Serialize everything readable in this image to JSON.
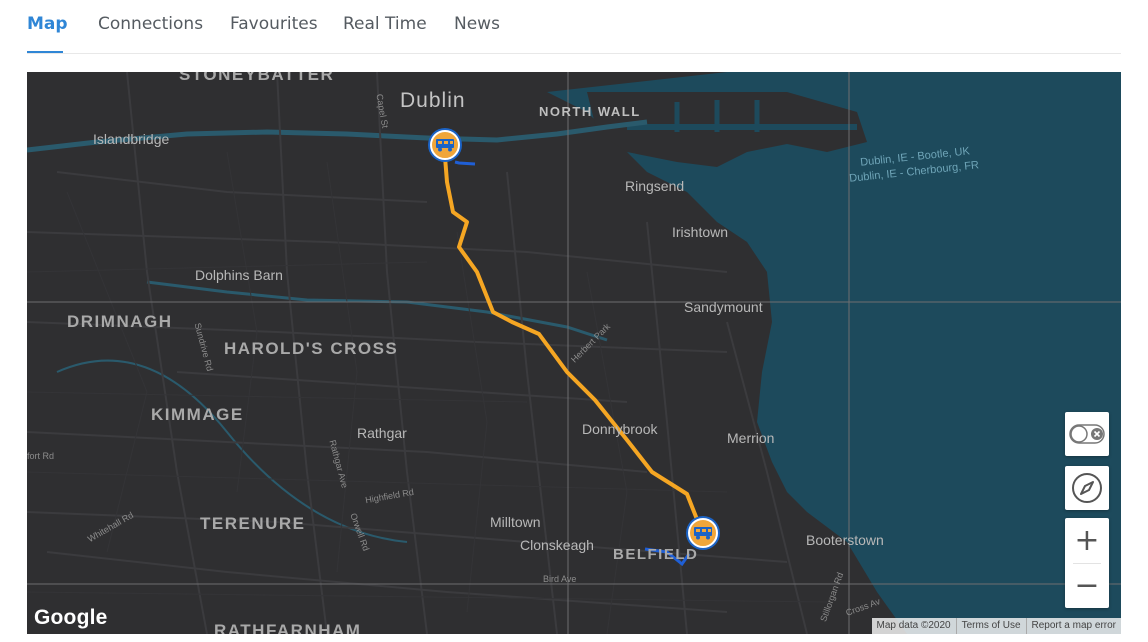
{
  "tabs": [
    {
      "label": "Map",
      "active": true
    },
    {
      "label": "Connections",
      "active": false
    },
    {
      "label": "Favourites",
      "active": false
    },
    {
      "label": "Real Time",
      "active": false
    },
    {
      "label": "News",
      "active": false
    }
  ],
  "map": {
    "labels": {
      "stoneybatter": "STONEYBATTER",
      "dublin": "Dublin",
      "north_wall": "NORTH WALL",
      "islandbridge": "Islandbridge",
      "ringsend": "Ringsend",
      "irishtown": "Irishtown",
      "dolphins_barn": "Dolphins Barn",
      "sandymount": "Sandymount",
      "drimnagh": "DRIMNAGH",
      "harolds_cross": "HAROLD'S CROSS",
      "kimmage": "KIMMAGE",
      "rathgar": "Rathgar",
      "donnybrook": "Donnybrook",
      "merrion": "Merrion",
      "terenure": "TERENURE",
      "milltown": "Milltown",
      "clonskeagh": "Clonskeagh",
      "belfield": "BELFIELD",
      "booterstown": "Booterstown",
      "rathfarnham": "RATHFARNHAM",
      "ferry_bootle": "Dublin, IE - Bootle, UK",
      "ferry_cherbourg": "Dublin, IE - Cherbourg, FR",
      "capel_st": "Capel St",
      "sundrive_rd": "Sundrive Rd",
      "herbert_park": "Herbert Park",
      "rathgar_ave": "Rathgar Ave",
      "highfield_rd": "Highfield Rd",
      "whitehall_rd": "Whitehall Rd",
      "orwell_rd": "Orwell Rd",
      "bird_ave": "Bird Ave",
      "fort_rd": "fort Rd",
      "cross_ave": "Cross Av",
      "stillorgan_rd": "Stillorgan Rd"
    },
    "route_color": "#f5a623",
    "segment_color": "#1f5fd6",
    "water_color": "#1d4a5c",
    "vehicle_icon": "bus-icon",
    "compass_icon": "compass-icon",
    "toggle_icon": "toggle-off-icon",
    "zoom_in": "+",
    "zoom_out": "−",
    "google_logo": "Google",
    "attribution": {
      "map_data": "Map data ©2020",
      "terms": "Terms of Use",
      "report": "Report a map error"
    }
  }
}
